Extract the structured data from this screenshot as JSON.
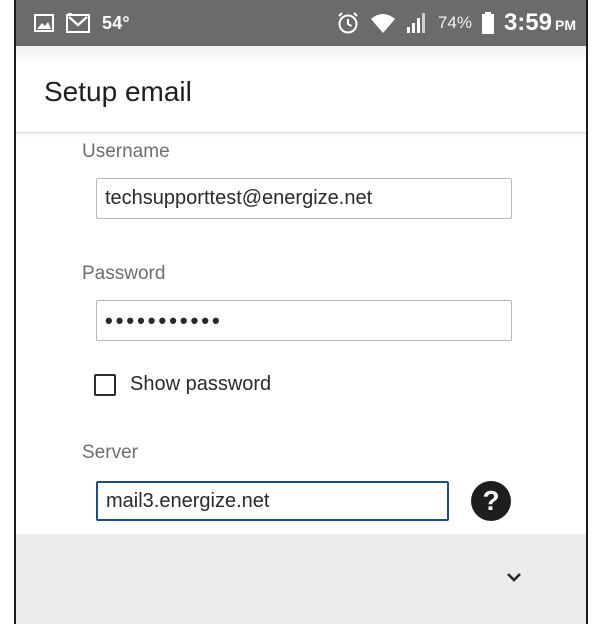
{
  "status_bar": {
    "temperature": "54°",
    "battery_percent": "74%",
    "time": "3:59",
    "ampm": "PM",
    "icons": [
      "gallery-icon",
      "gmail-icon",
      "alarm-icon",
      "wifi-icon",
      "signal-icon",
      "battery-icon"
    ]
  },
  "appbar": {
    "title": "Setup email"
  },
  "form": {
    "username_label": "Username",
    "username_value": "techsupporttest@energize.net",
    "password_label": "Password",
    "password_value": "•••••••••••",
    "show_password_label": "Show password",
    "show_password_checked": false,
    "server_label": "Server",
    "server_value": "mail3.energize.net",
    "help_symbol": "?"
  },
  "colors": {
    "status_bar_bg": "#6b6b6b",
    "focus_border": "#1f4e79",
    "bottom_bar_bg": "#ececec"
  }
}
